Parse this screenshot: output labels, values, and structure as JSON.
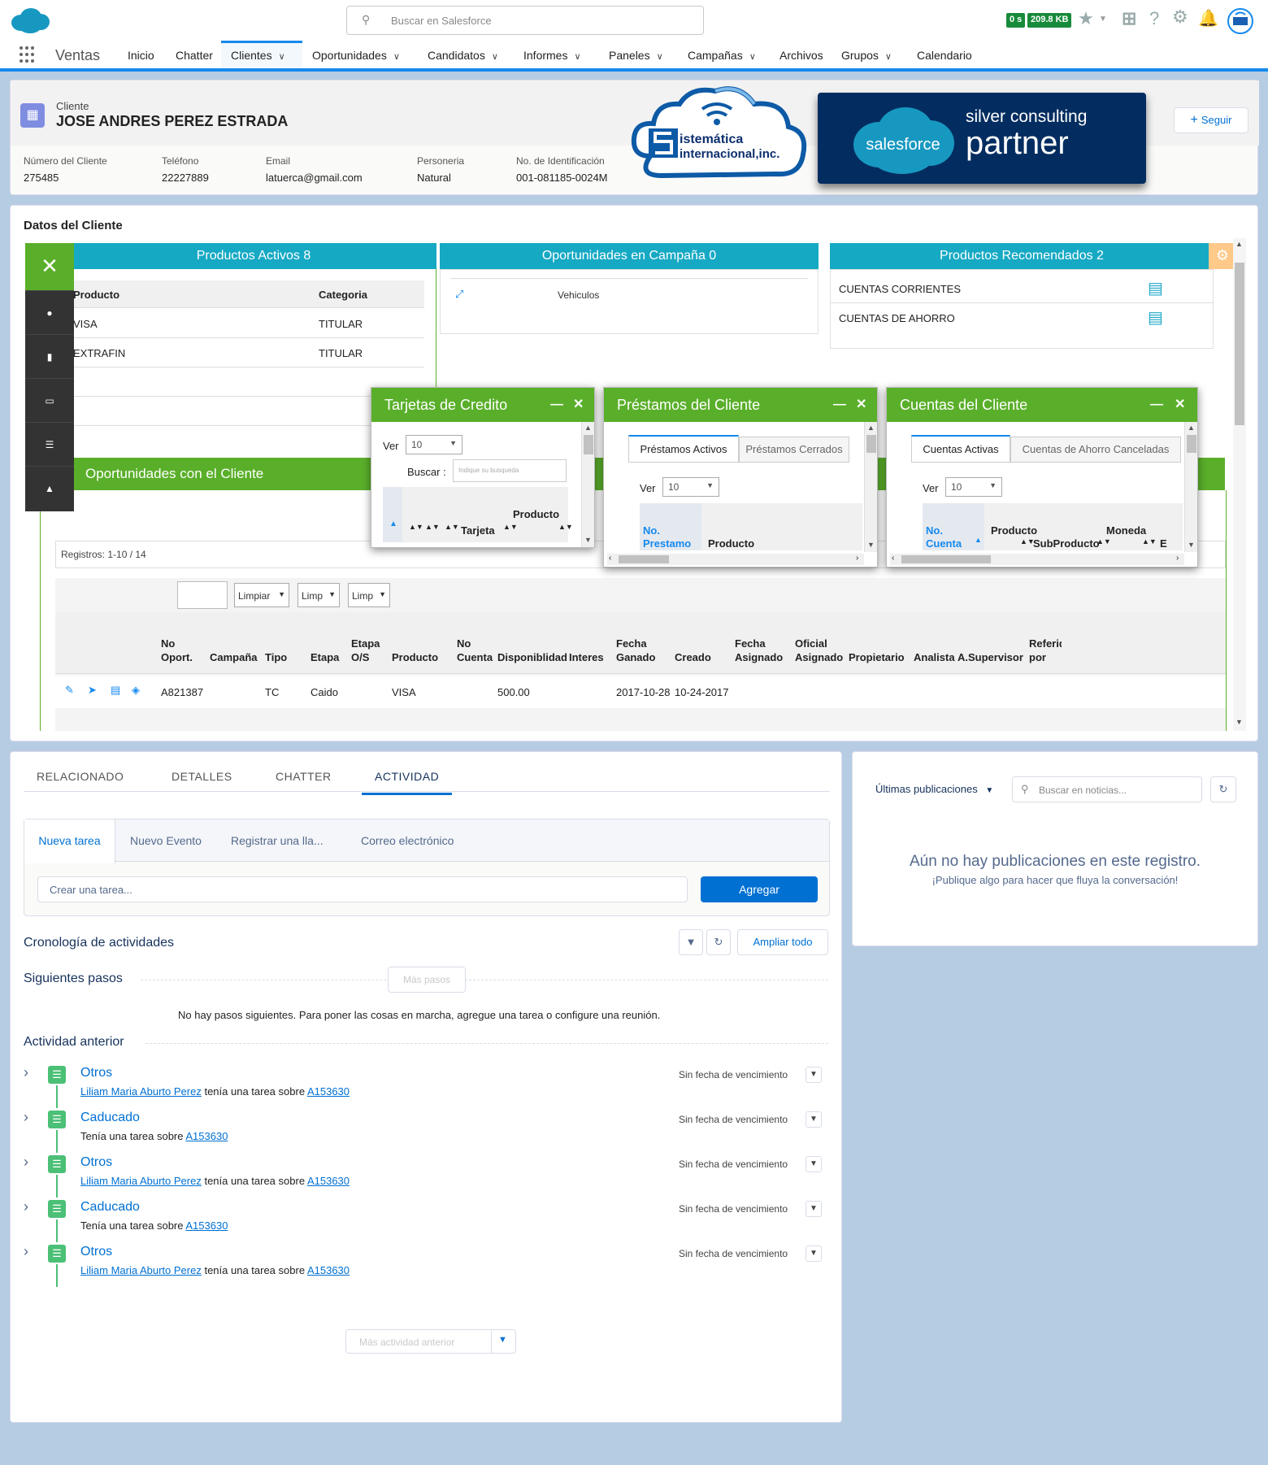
{
  "header": {
    "search_placeholder": "Buscar en Salesforce",
    "badge_time": "0 s",
    "badge_size": "209.8 KB"
  },
  "app": {
    "name": "Ventas",
    "nav": [
      {
        "label": "Inicio",
        "chevron": false
      },
      {
        "label": "Chatter",
        "chevron": false
      },
      {
        "label": "Clientes",
        "chevron": true,
        "active": true
      },
      {
        "label": "Oportunidades",
        "chevron": true
      },
      {
        "label": "Candidatos",
        "chevron": true
      },
      {
        "label": "Informes",
        "chevron": true
      },
      {
        "label": "Paneles",
        "chevron": true
      },
      {
        "label": "Campañas",
        "chevron": true
      },
      {
        "label": "Archivos",
        "chevron": false
      },
      {
        "label": "Grupos",
        "chevron": true
      },
      {
        "label": "Calendario",
        "chevron": false
      }
    ]
  },
  "record": {
    "type_label": "Cliente",
    "name": "JOSE ANDRES PEREZ ESTRADA",
    "follow_label": "Seguir",
    "fields": [
      {
        "label": "Número del Cliente",
        "value": "275485"
      },
      {
        "label": "Teléfono",
        "value": "22227889"
      },
      {
        "label": "Email",
        "value": "latuerca@gmail.com"
      },
      {
        "label": "Personeria",
        "value": "Natural"
      },
      {
        "label": "No. de Identificación",
        "value": "001-081185-0024M"
      }
    ]
  },
  "partner": {
    "sf_logo_text": "salesforce",
    "line1": "silver consulting",
    "line2": "partner",
    "sis_line1": "istemática",
    "sis_line2": "internacional,inc."
  },
  "datos": {
    "title": "Datos del Cliente",
    "productos_activos": {
      "title": "Productos Activos 8",
      "headers": [
        "Producto",
        "Categoria"
      ],
      "rows": [
        [
          "VISA",
          "TITULAR"
        ],
        [
          "EXTRAFIN",
          "TITULAR"
        ]
      ]
    },
    "oportunidades_campana": {
      "title": "Oportunidades en Campaña 0",
      "item": "Vehiculos"
    },
    "productos_recomendados": {
      "title": "Productos Recomendados 2",
      "items": [
        "CUENTAS CORRIENTES",
        "CUENTAS DE AHORRO"
      ]
    },
    "oportunidades_cliente": {
      "title": "Oportunidades con el Cliente",
      "registros": "Registros: 1-10 / 14",
      "filters": [
        "Limpiar",
        "Limp",
        "Limp"
      ],
      "headers": [
        "No Oport.",
        "Campaña",
        "Tipo",
        "Etapa",
        "Etapa O/S",
        "Producto",
        "No Cuenta",
        "Disponiblidad",
        "Interes",
        "Fecha Ganado",
        "Creado",
        "Fecha Asignado",
        "Oficial Asignado",
        "Propietario",
        "Analista",
        "A.Supervisor",
        "Referido por"
      ],
      "row": [
        "A821387",
        "",
        "TC",
        "Caido",
        "",
        "VISA",
        "",
        "500.00",
        "",
        "2017-10-28",
        "10-24-2017",
        "",
        "",
        "",
        "",
        "",
        ""
      ]
    }
  },
  "popups": {
    "tarjetas": {
      "title": "Tarjetas de Credito",
      "ver_label": "Ver",
      "ver_value": "10",
      "buscar_label": "Buscar :",
      "buscar_placeholder": "Indique su busqueda",
      "col_tarjeta": "Tarjeta",
      "col_producto": "Producto"
    },
    "prestamos": {
      "title": "Préstamos del Cliente",
      "tab_active": "Préstamos Activos",
      "tab_other": "Préstamos Cerrados",
      "ver_label": "Ver",
      "ver_value": "10",
      "col_no_line1": "No.",
      "col_no_line2": "Prestamo",
      "col_producto": "Producto"
    },
    "cuentas": {
      "title": "Cuentas del Cliente",
      "tab_active": "Cuentas Activas",
      "tab_other": "Cuentas de Ahorro Canceladas",
      "ver_label": "Ver",
      "ver_value": "10",
      "col_no_line1": "No.",
      "col_no_line2": "Cuenta",
      "col_producto": "Producto",
      "col_subproducto": "SubProducto",
      "col_moneda": "Moneda",
      "col_e": "E"
    }
  },
  "activity": {
    "tabs": [
      "RELACIONADO",
      "DETALLES",
      "CHATTER",
      "ACTIVIDAD"
    ],
    "composer_tabs": [
      "Nueva tarea",
      "Nuevo Evento",
      "Registrar una lla...",
      "Correo electrónico"
    ],
    "task_placeholder": "Crear una tarea...",
    "add_label": "Agregar",
    "timeline_title": "Cronología de actividades",
    "expand_label": "Ampliar todo",
    "next_steps_title": "Siguientes pasos",
    "more_steps_label": "Más pasos",
    "no_steps_text": "No hay pasos siguientes. Para poner las cosas en marcha, agregue una tarea o configure una reunión.",
    "past_title": "Actividad anterior",
    "items": [
      {
        "title": "Otros",
        "person": "Liliam Maria Aburto Perez",
        "mid": " tenía una tarea sobre ",
        "ref": "A153630",
        "due": "Sin fecha de vencimiento"
      },
      {
        "title": "Caducado",
        "person": "",
        "mid": "Tenía una tarea sobre ",
        "ref": "A153630",
        "due": "Sin fecha de vencimiento"
      },
      {
        "title": "Otros",
        "person": "Liliam Maria Aburto Perez",
        "mid": " tenía una tarea sobre ",
        "ref": "A153630",
        "due": "Sin fecha de vencimiento"
      },
      {
        "title": "Caducado",
        "person": "",
        "mid": "Tenía una tarea sobre ",
        "ref": "A153630",
        "due": "Sin fecha de vencimiento"
      },
      {
        "title": "Otros",
        "person": "Liliam Maria Aburto Perez",
        "mid": " tenía una tarea sobre ",
        "ref": "A153630",
        "due": "Sin fecha de vencimiento"
      }
    ],
    "more_activity_label": "Más actividad anterior"
  },
  "feed": {
    "filter_label": "Últimas publicaciones",
    "search_placeholder": "Buscar en noticias...",
    "empty_title": "Aún no hay publicaciones en este registro.",
    "empty_sub": "¡Publique algo para hacer que fluya la conversación!"
  },
  "colors": {
    "brand_blue": "#1589ee",
    "action_blue": "#0070d2",
    "teal": "#16a9c4",
    "green": "#5aaf2a",
    "timeline_green": "#4bc076"
  }
}
